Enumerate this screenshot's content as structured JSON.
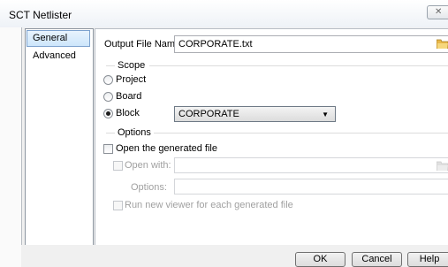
{
  "window": {
    "title": "SCT Netlister"
  },
  "nav": {
    "items": [
      "General",
      "Advanced"
    ]
  },
  "general": {
    "output_label": "Output File Name:",
    "output_value": "CORPORATE.txt",
    "scope": {
      "legend": "Scope",
      "project": "Project",
      "board": "Board",
      "block": "Block",
      "block_value": "CORPORATE",
      "selected": "Block"
    },
    "options": {
      "legend": "Options",
      "open_generated": "Open the generated file",
      "open_with": "Open with:",
      "options_label": "Options:",
      "run_new_viewer": "Run new viewer for each generated file"
    }
  },
  "buttons": {
    "ok": "OK",
    "cancel": "Cancel",
    "help": "Help"
  },
  "colors": {
    "folder": "#e8b74a",
    "selection_border": "#7da2ce"
  }
}
